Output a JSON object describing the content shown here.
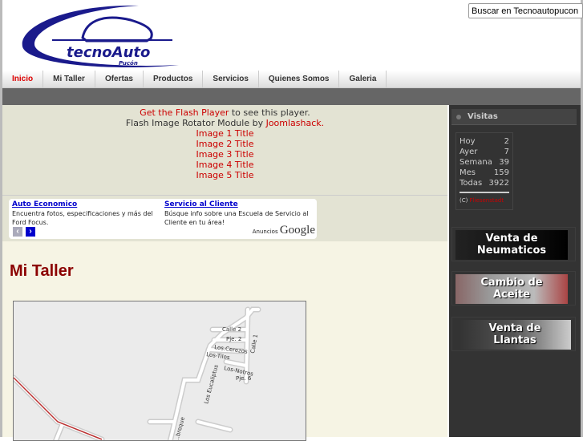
{
  "header": {
    "logo_text": "tecnoAuto",
    "logo_subtext": "Pucón",
    "search_placeholder": "Buscar en Tecnoautopucon"
  },
  "nav": [
    {
      "label": "Inicio",
      "active": true
    },
    {
      "label": "Mi Taller"
    },
    {
      "label": "Ofertas"
    },
    {
      "label": "Productos"
    },
    {
      "label": "Servicios"
    },
    {
      "label": "Quienes Somos"
    },
    {
      "label": "Galeria"
    }
  ],
  "flash": {
    "get_link": "Get the Flash Player",
    "get_rest": " to see this player.",
    "module_prefix": "Flash Image Rotator Module by ",
    "module_link": "Joomlashack.",
    "images": [
      "Image 1 Title",
      "Image 2 Title",
      "Image 3 Title",
      "Image 4 Title",
      "Image 5 Title"
    ]
  },
  "ads": [
    {
      "title": "Auto Economico",
      "text": "Encuentra fotos, especificaciones y más del Ford Focus."
    },
    {
      "title": "Servicio al Cliente",
      "text": "Búsque info sobre una Escuela de Servicio al Cliente en tu área!"
    }
  ],
  "ads_label": "Anuncios",
  "ads_brand": "Google",
  "main": {
    "title": "Mi Taller"
  },
  "map_labels": [
    "Calle 2",
    "Pje. 2",
    "Los.Cerezos",
    "Los-Tilos",
    "Calle 1",
    "Los-Notros",
    "Pje. 6",
    "Los Eucaliptus",
    "...breque"
  ],
  "visitas": {
    "title": "Visitas",
    "rows": [
      {
        "label": "Hoy",
        "value": "2"
      },
      {
        "label": "Ayer",
        "value": "7"
      },
      {
        "label": "Semana",
        "value": "39"
      },
      {
        "label": "Mes",
        "value": "159"
      },
      {
        "label": "Todas",
        "value": "3922"
      }
    ],
    "copyright": "(C)",
    "credit": "Fliesenstadt"
  },
  "banners": [
    {
      "line1": "Venta de",
      "line2": "Neumaticos"
    },
    {
      "line1": "Cambio de",
      "line2": "Aceite"
    },
    {
      "line1": "Venta de",
      "line2": "Llantas"
    }
  ]
}
